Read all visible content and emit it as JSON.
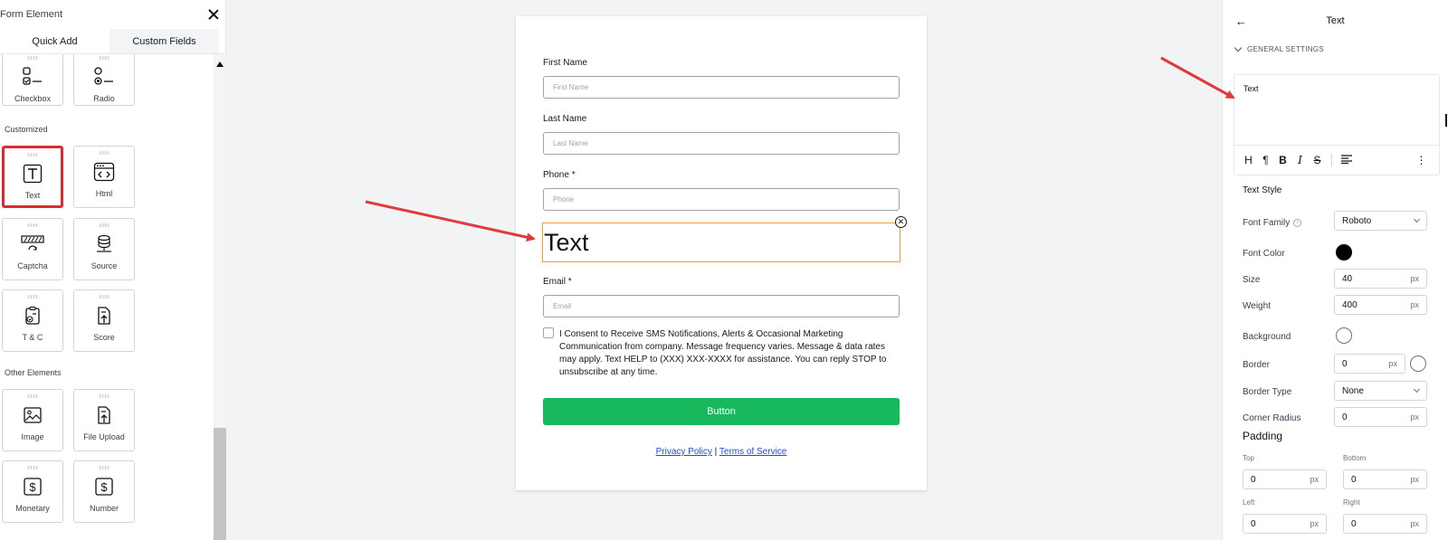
{
  "left_panel": {
    "title": "Form Element",
    "tabs": [
      {
        "label": "Quick Add"
      },
      {
        "label": "Custom Fields"
      }
    ],
    "sections": {
      "customized": "Customized",
      "other": "Other Elements"
    },
    "tiles": {
      "checkbox": "Checkbox",
      "radio": "Radio",
      "text": "Text",
      "html": "Html",
      "captcha": "Captcha",
      "source": "Source",
      "tc": "T & C",
      "score": "Score",
      "image": "Image",
      "file_upload": "File Upload",
      "monetary": "Monetary",
      "number": "Number"
    }
  },
  "form": {
    "first_name": {
      "label": "First Name",
      "placeholder": "First Name"
    },
    "last_name": {
      "label": "Last Name",
      "placeholder": "Last Name"
    },
    "phone": {
      "label": "Phone  *",
      "placeholder": "Phone"
    },
    "text_element": "Text",
    "email": {
      "label": "Email  *",
      "placeholder": "Email"
    },
    "consent": "I Consent to Receive SMS Notifications, Alerts & Occasional Marketing Communication from company. Message frequency varies. Message & data rates may apply. Text HELP to (XXX) XXX-XXXX for assistance. You can reply STOP to unsubscribe at any time.",
    "button": "Button",
    "privacy": "Privacy Policy",
    "separator": "|",
    "terms": "Terms of Service"
  },
  "right_panel": {
    "title": "Text",
    "general_settings": "GENERAL SETTINGS",
    "editor_content": "Text",
    "toolbar": {
      "heading": "H",
      "paragraph": "¶",
      "bold": "B",
      "italic": "I",
      "strike": "S",
      "more": "⋮"
    },
    "text_style": "Text Style",
    "font_family": {
      "label": "Font Family",
      "value": "Roboto"
    },
    "font_color": {
      "label": "Font Color",
      "value": "#000000"
    },
    "size": {
      "label": "Size",
      "value": "40",
      "unit": "px"
    },
    "weight": {
      "label": "Weight",
      "value": "400",
      "unit": "px"
    },
    "background": {
      "label": "Background"
    },
    "border": {
      "label": "Border",
      "value": "0",
      "unit": "px"
    },
    "border_type": {
      "label": "Border Type",
      "value": "None"
    },
    "corner_radius": {
      "label": "Corner Radius",
      "value": "0",
      "unit": "px"
    },
    "padding": {
      "label": "Padding",
      "top": {
        "label": "Top",
        "value": "0",
        "unit": "px"
      },
      "bottom": {
        "label": "Bottom",
        "value": "0",
        "unit": "px"
      },
      "left": {
        "label": "Left",
        "value": "0",
        "unit": "px"
      },
      "right": {
        "label": "Right",
        "value": "0",
        "unit": "px"
      }
    }
  },
  "colors": {
    "accent_green": "#17b95c",
    "selection_red": "#d92d2d",
    "arrow_red": "#e03a3a",
    "focus_orange": "#f39c3a",
    "link_blue": "#1d4ed8"
  }
}
